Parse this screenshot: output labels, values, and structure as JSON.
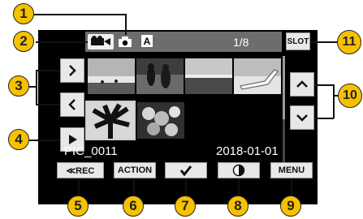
{
  "callouts": [
    "1",
    "2",
    "3",
    "4",
    "5",
    "6",
    "7",
    "8",
    "9",
    "10",
    "11"
  ],
  "top_bar": {
    "counter": "1/8",
    "slot_label": "SLOT",
    "mode_letter": "A"
  },
  "side_buttons": {
    "next_page": ">",
    "prev_page": "<",
    "play": "▶",
    "scroll_up": "^",
    "scroll_down": "v"
  },
  "file_info": {
    "filename": "PIC_0011",
    "date": "2018-01-01"
  },
  "bottom_buttons": {
    "rec": "≪REC",
    "action": "ACTION",
    "check": "✔",
    "half": "◐",
    "menu": "MENU"
  },
  "thumbnails": [
    "beach-scene",
    "people-silhouettes",
    "sunset-water",
    "lounge-chair",
    "palm-leaf",
    "flower-bouquet"
  ]
}
